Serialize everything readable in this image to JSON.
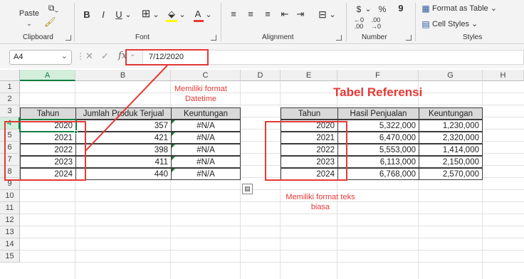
{
  "ribbon": {
    "clipboard": {
      "paste_label": "Paste",
      "group_label": "Clipboard"
    },
    "font": {
      "group_label": "Font",
      "bold": "B",
      "italic": "I",
      "underline": "U",
      "font_color_letter": "A"
    },
    "alignment": {
      "group_label": "Alignment"
    },
    "number": {
      "group_label": "Number",
      "currency": "$",
      "percent": "%",
      "comma": "9"
    },
    "styles": {
      "group_label": "Styles",
      "format_as_table": "Format as Table",
      "cell_styles": "Cell Styles"
    }
  },
  "formula_bar": {
    "name_box": "A4",
    "fx_label": "fx",
    "value": "7/12/2020"
  },
  "columns": [
    "A",
    "B",
    "C",
    "D",
    "E",
    "F",
    "G",
    "H"
  ],
  "rows": [
    "1",
    "2",
    "3",
    "4",
    "5",
    "6",
    "7",
    "8",
    "9",
    "10",
    "11",
    "12",
    "13",
    "14",
    "15"
  ],
  "left_table": {
    "headers": [
      "Tahun",
      "Jumlah Produk Terjual",
      "Keuntungan"
    ],
    "rows": [
      [
        "2020",
        "357",
        "#N/A"
      ],
      [
        "2021",
        "421",
        "#N/A"
      ],
      [
        "2022",
        "398",
        "#N/A"
      ],
      [
        "2023",
        "411",
        "#N/A"
      ],
      [
        "2024",
        "440",
        "#N/A"
      ]
    ]
  },
  "ref_table": {
    "title": "Tabel Referensi",
    "headers": [
      "Tahun",
      "Hasil Penjualan",
      "Keuntungan"
    ],
    "rows": [
      [
        "2020",
        "5,322,000",
        "1,230,000"
      ],
      [
        "2021",
        "6,470,000",
        "2,320,000"
      ],
      [
        "2022",
        "5,553,000",
        "1,414,000"
      ],
      [
        "2023",
        "6,113,000",
        "2,150,000"
      ],
      [
        "2024",
        "6,768,000",
        "2,570,000"
      ]
    ]
  },
  "annotations": {
    "datetime_line1": "Memiliki format",
    "datetime_line2": "Datetime",
    "text_line1": "Memiliki format teks",
    "text_line2": "biasa"
  },
  "colors": {
    "accent_green": "#107c41",
    "annotation_red": "#e53935",
    "header_fill": "#d9d9d9"
  }
}
